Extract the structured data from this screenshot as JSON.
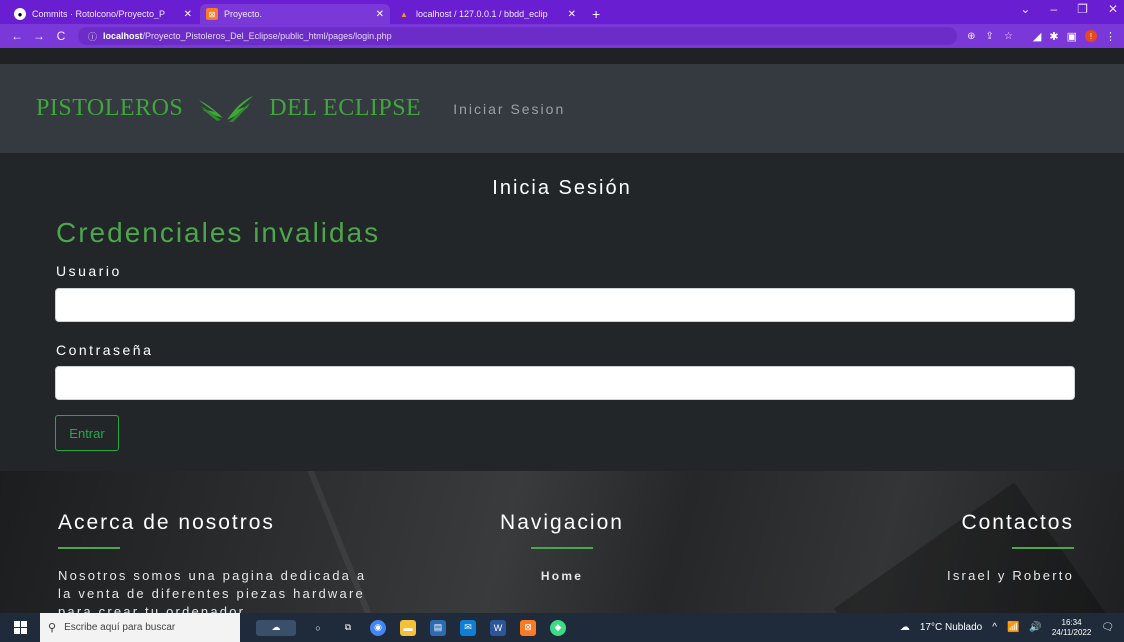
{
  "browser": {
    "tabs": [
      {
        "title": "Commits · Rotolcono/Proyecto_P",
        "favicon": "github-icon",
        "active": false
      },
      {
        "title": "Proyecto.",
        "favicon": "xampp-icon",
        "active": true
      },
      {
        "title": "localhost / 127.0.0.1 / bbdd_eclip",
        "favicon": "phpmyadmin-icon",
        "active": false
      }
    ],
    "url_host": "localhost",
    "url_path": "/Proyecto_Pistoleros_Del_Eclipse/public_html/pages/login.php"
  },
  "header": {
    "brand_left": "PISTOLEROS",
    "brand_right": "DEL ECLIPSE",
    "nav_link": "Iniciar Sesion"
  },
  "login": {
    "title": "Inicia Sesión",
    "error": "Credenciales invalidas",
    "user_label": "Usuario",
    "user_value": "",
    "password_label": "Contraseña",
    "password_value": "",
    "submit_label": "Entrar"
  },
  "footer": {
    "about_title": "Acerca de nosotros",
    "about_text": "Nosotros somos una pagina dedicada a la venta de diferentes piezas hardware para crear tu ordenador",
    "nav_title": "Navigacion",
    "nav_home": "Home",
    "contact_title": "Contactos",
    "contact_text": "Israel y Roberto"
  },
  "taskbar": {
    "search_placeholder": "Escribe aquí para buscar",
    "weather": "17°C Nublado",
    "time": "16:34",
    "date": "24/11/2022"
  },
  "colors": {
    "accent_green": "#4ca64b",
    "browser_purple": "#7b38d8"
  }
}
